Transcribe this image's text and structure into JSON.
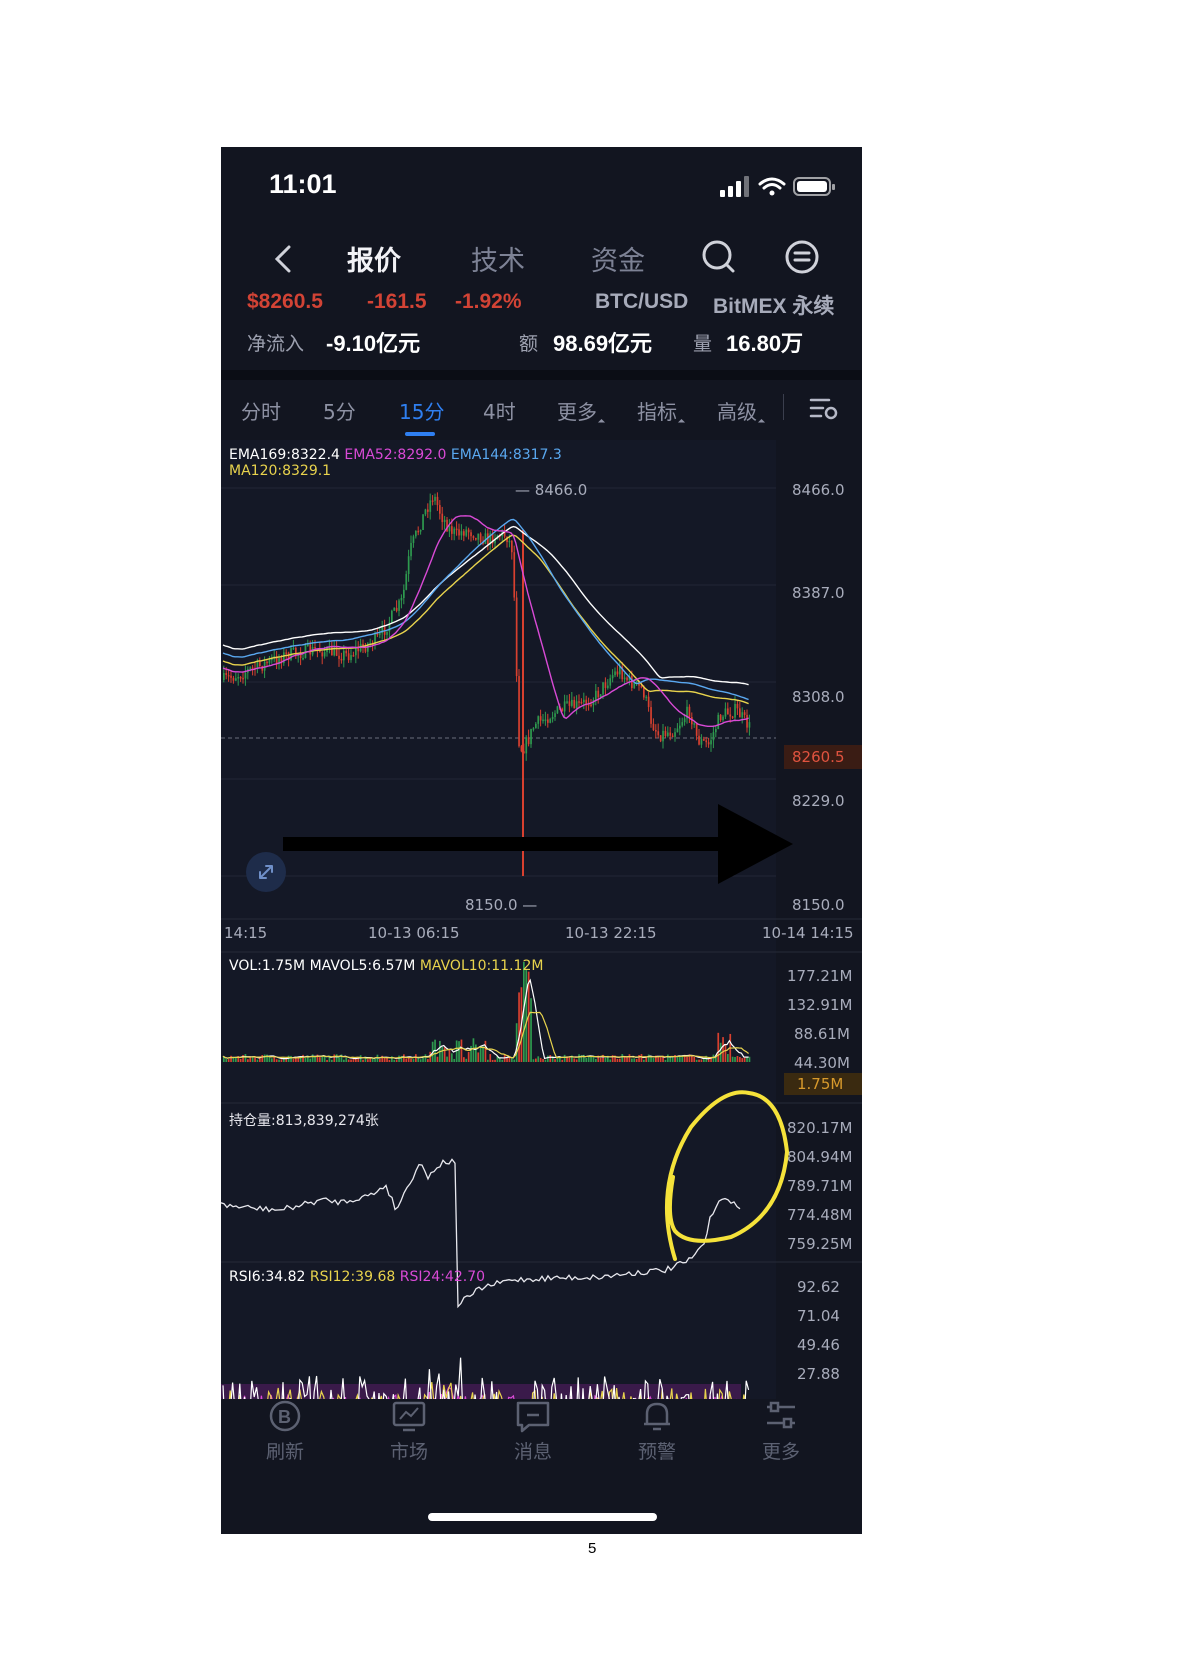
{
  "status_bar": {
    "time": "11:01"
  },
  "nav": {
    "tabs": [
      "报价",
      "技术",
      "资金"
    ]
  },
  "ticker": {
    "price": "$8260.5",
    "change": "-161.5",
    "change_pct": "-1.92%",
    "pair": "BTC/USD",
    "exchange": "BitMEX 永续",
    "net_inflow_label": "净流入",
    "net_inflow": "-9.10亿元",
    "amount_label": "额",
    "amount": "98.69亿元",
    "volume_label": "量",
    "volume": "16.80万"
  },
  "period_tabs": [
    "分时",
    "5分",
    "15分",
    "4时",
    "更多",
    "指标",
    "高级"
  ],
  "active_period": "15分",
  "colors": {
    "up": "#2e9a4f",
    "down": "#d8402f",
    "ema169": "#ffffff",
    "ema52": "#d94ad6",
    "ema144": "#5aa8f0",
    "ma120": "#e8d34d",
    "annotation": "#f5e23a"
  },
  "main_chart": {
    "legend": {
      "ema169": "EMA169:8322.4",
      "ema52": "EMA52:8292.0",
      "ema144": "EMA144:8317.3",
      "ma120": "MA120:8329.1"
    },
    "y_ticks": [
      "8466.0",
      "8387.0",
      "8308.0",
      "8229.0",
      "8150.0"
    ],
    "high_label": "8466.0",
    "low_label": "8150.0",
    "current_price": "8260.5",
    "x_ticks": [
      "14:15",
      "10-13 06:15",
      "10-13 22:15",
      "10-14 14:15"
    ]
  },
  "volume_panel": {
    "legend": {
      "vol": "VOL:1.75M",
      "mavol5": "MAVOL5:6.57M",
      "mavol10": "MAVOL10:11.12M"
    },
    "y_ticks": [
      "177.21M",
      "132.91M",
      "88.61M",
      "44.30M"
    ],
    "current": "1.75M"
  },
  "oi_panel": {
    "legend": "持仓量:813,839,274张",
    "y_ticks": [
      "820.17M",
      "804.94M",
      "789.71M",
      "774.48M",
      "759.25M"
    ]
  },
  "rsi_panel": {
    "legend": {
      "rsi6": "RSI6:34.82",
      "rsi12": "RSI12:39.68",
      "rsi24": "RSI24:42.70"
    },
    "y_ticks": [
      "92.62",
      "71.04",
      "49.46",
      "27.88"
    ]
  },
  "tab_bar": [
    {
      "label": "刷新",
      "icon": "bitcoin-icon"
    },
    {
      "label": "市场",
      "icon": "chart-monitor-icon"
    },
    {
      "label": "消息",
      "icon": "message-icon"
    },
    {
      "label": "预警",
      "icon": "bell-icon"
    },
    {
      "label": "更多",
      "icon": "sliders-icon"
    }
  ],
  "page_number": "5"
}
